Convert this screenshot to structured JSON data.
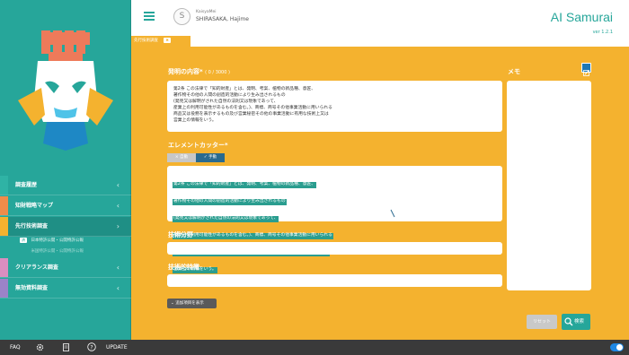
{
  "header": {
    "user_org": "KaisyaMei",
    "user_name": "SHIRASAKA, Hajime",
    "avatar_letter": "S",
    "app_name": "AI Samurai",
    "app_version": "ver 1.2.1"
  },
  "tabs": [
    {
      "label": "先行技術調査",
      "close": "✖"
    }
  ],
  "sidebar": {
    "items": [
      {
        "label": "調査履歴",
        "chevron": "‹",
        "strip": "#2fb3a5"
      },
      {
        "label": "知財戦略マップ",
        "chevron": "‹",
        "strip": "#f08c4a"
      },
      {
        "label": "先行技術調査",
        "chevron": "›",
        "strip": "#f4b22f"
      },
      {
        "label": "クリアランス調査",
        "chevron": "‹",
        "strip": "#d98ec0"
      },
      {
        "label": "無効資料調査",
        "chevron": "‹",
        "strip": "#9b83c8"
      }
    ],
    "sub_items": [
      {
        "tag": "済",
        "label": "日本特許公開・公開特許公報"
      },
      {
        "tag": "",
        "label": "米国特許公開・公開特許公報"
      }
    ]
  },
  "main": {
    "invention_label": "発明の内容*",
    "invention_counter": "( 0 / 3000 )",
    "invention_text": [
      "第2条 この法律で「知的財産」とは、発明、考案、植物の新品種、意匠、",
      "著作物その他の人間の創造的活動により生み出されるもの",
      "(発見又は解明がされた自然の法則又は現象であって、",
      "産業上の利用可能性があるものを含む。)、商標、商号その他事業活動に用いられる",
      "商品又は役務を表示するもの及び営業秘密その他の事業活動に有用な技術上又は",
      "営業上の情報をいう。"
    ],
    "element_cutter_label": "エレメントカッター*",
    "toggle_auto": "× 自動",
    "toggle_manual": "✓ 手動",
    "cutter_lines": [
      "第2条 この法律で「知的財産」とは、発明、考案、植物の新品種、意匠、",
      "著作物その他の人間の創造的活動により生み出されるもの",
      "(発見又は解明がされた自然の法則又は現象であって、",
      "産業上の利用可能性があるものを含む。)、商標、商号その他事業活動に用いられる",
      "商品又は役務を表示するもの及び営業秘密その他の事業活動に有用な技術上又は",
      "営業上の情報をいう。"
    ],
    "tech_field_label": "技術分野",
    "tech_feature_label": "技術的特徴",
    "expand_button": "⌄ 追加項目を表示",
    "memo_label": "メモ",
    "reset_button": "リセット",
    "search_button": "検索"
  },
  "footer": {
    "faq": "FAQ",
    "update": "UPDATE",
    "help": "?"
  },
  "colors": {
    "teal": "#26a69a",
    "orange": "#f4b22f",
    "highlight": "#2a9d8f",
    "manual_blue": "#2a6a8f"
  }
}
